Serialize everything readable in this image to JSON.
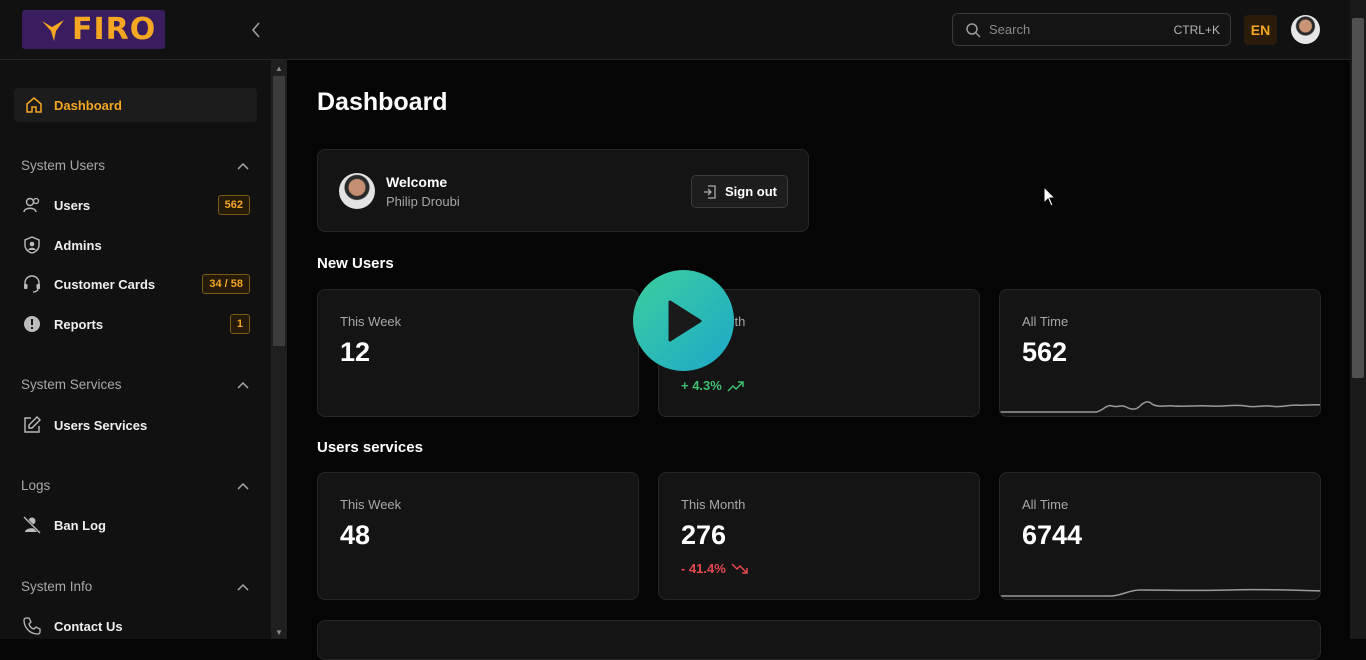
{
  "brand": {
    "logo_text": "FIRO"
  },
  "header": {
    "search_placeholder": "Search",
    "search_shortcut": "CTRL+K",
    "language": "EN"
  },
  "sidebar": {
    "active_item": "Dashboard",
    "sections": [
      {
        "title": "System Users",
        "items": [
          {
            "label": "Users",
            "badge": "562",
            "icon": "users-icon"
          },
          {
            "label": "Admins",
            "badge": "",
            "icon": "shield-user-icon"
          },
          {
            "label": "Customer Cards",
            "badge": "34 / 58",
            "icon": "headset-icon"
          },
          {
            "label": "Reports",
            "badge": "1",
            "icon": "alert-icon"
          }
        ]
      },
      {
        "title": "System Services",
        "items": [
          {
            "label": "Users Services",
            "badge": "",
            "icon": "edit-icon"
          }
        ]
      },
      {
        "title": "Logs",
        "items": [
          {
            "label": "Ban Log",
            "badge": "",
            "icon": "user-ban-icon"
          }
        ]
      },
      {
        "title": "System Info",
        "items": [
          {
            "label": "Contact Us",
            "badge": "",
            "icon": "phone-icon"
          }
        ]
      }
    ]
  },
  "main": {
    "title": "Dashboard",
    "welcome": {
      "greeting": "Welcome",
      "name": "Philip Droubi",
      "signout_label": "Sign out"
    },
    "new_users": {
      "title": "New Users",
      "cards": [
        {
          "label": "This Week",
          "value": "12",
          "change": ""
        },
        {
          "label": "This Month",
          "value": "",
          "change": "+ 4.3%"
        },
        {
          "label": "All Time",
          "value": "562",
          "change": ""
        }
      ]
    },
    "users_services": {
      "title": "Users services",
      "cards": [
        {
          "label": "This Week",
          "value": "48",
          "change": ""
        },
        {
          "label": "This Month",
          "value": "276",
          "change": "- 41.4%"
        },
        {
          "label": "All Time",
          "value": "6744",
          "change": ""
        }
      ]
    }
  },
  "colors": {
    "accent": "#f5a623",
    "positive": "#3fbf6f",
    "negative": "#e5484d",
    "background": "#050505",
    "panel": "#141415"
  }
}
